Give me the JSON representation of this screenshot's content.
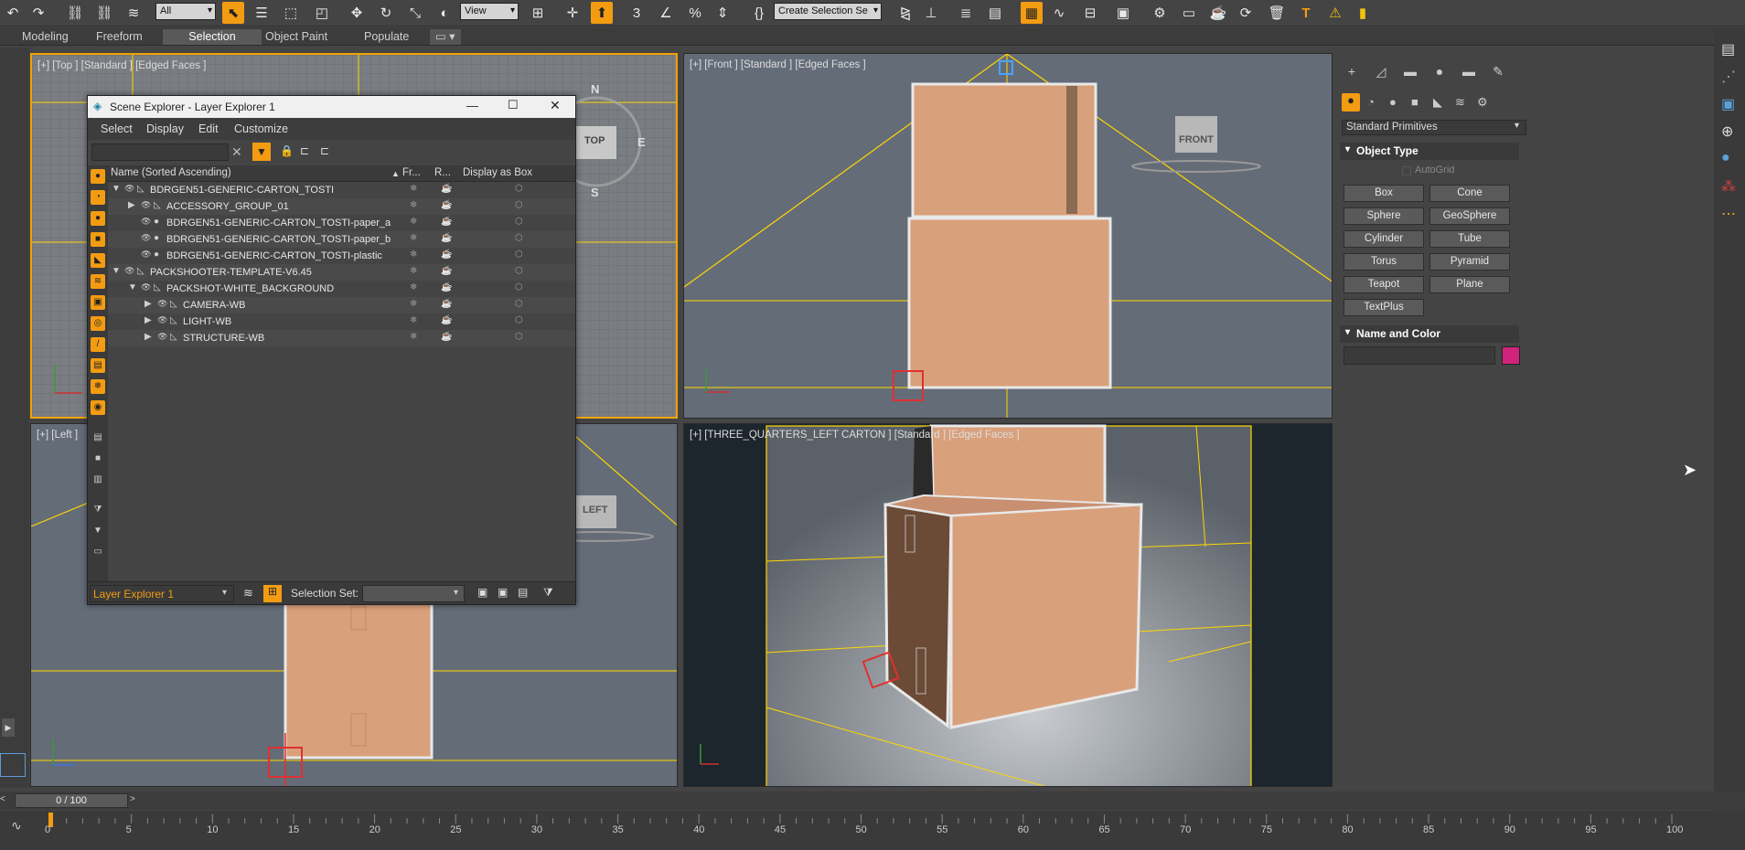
{
  "toolbar": {
    "filter_dropdown": "All",
    "refcoord_dropdown": "View",
    "selection_set": "Create Selection Se",
    "icons": [
      "undo-icon",
      "redo-icon",
      "link-icon",
      "unlink-icon",
      "bind-spacewarp-icon",
      "select-icon",
      "select-by-name-icon",
      "rect-region-icon",
      "window-crossing-icon",
      "move-icon",
      "rotate-icon",
      "scale-icon",
      "placement-icon",
      "pivot-icon",
      "manipulate-icon",
      "snaps-icon",
      "angle-snap-icon",
      "percent-snap-icon",
      "spinner-snap-icon",
      "edit-named-sel-icon",
      "mirror-icon",
      "align-icon",
      "layer-icon",
      "ribbon-icon",
      "curve-editor-icon",
      "schematic-icon",
      "material-editor-icon",
      "render-setup-icon",
      "frame-window-icon",
      "render-icon",
      "render-iter-icon",
      "arnold-icon",
      "trash-icon",
      "text-icon",
      "warning-icon",
      "tag-icon"
    ]
  },
  "ribbon": {
    "tabs": [
      "Modeling",
      "Freeform",
      "Selection",
      "Object Paint",
      "Populate"
    ],
    "selected": "Selection"
  },
  "viewports": {
    "top": {
      "label": "[+] [Top ] [Standard ] [Edged Faces ]",
      "cube": "TOP",
      "compass": [
        "N",
        "E",
        "S"
      ]
    },
    "front": {
      "label": "[+] [Front ] [Standard ] [Edged Faces ]",
      "cube": "FRONT"
    },
    "left": {
      "label": "[+] [Left ]",
      "cube": "LEFT"
    },
    "persp": {
      "label": "[+] [THREE_QUARTERS_LEFT CARTON ] [Standard ] [Edged Faces ]"
    }
  },
  "explorer": {
    "title": "Scene Explorer - Layer Explorer 1",
    "menus": [
      "Select",
      "Display",
      "Edit",
      "Customize"
    ],
    "columns": {
      "name": "Name (Sorted Ascending)",
      "freeze": "Fr...",
      "render": "R...",
      "box": "Display as Box"
    },
    "rows": [
      {
        "name": "BDRGEN51-GENERIC-CARTON_TOSTI",
        "indent": 0,
        "expander": "▼",
        "kind": "layer"
      },
      {
        "name": "ACCESSORY_GROUP_01",
        "indent": 1,
        "expander": "▶",
        "kind": "layer"
      },
      {
        "name": "BDRGEN51-GENERIC-CARTON_TOSTI-paper_a",
        "indent": 1,
        "expander": "",
        "kind": "object"
      },
      {
        "name": "BDRGEN51-GENERIC-CARTON_TOSTI-paper_b",
        "indent": 1,
        "expander": "",
        "kind": "object"
      },
      {
        "name": "BDRGEN51-GENERIC-CARTON_TOSTI-plastic",
        "indent": 1,
        "expander": "",
        "kind": "object"
      },
      {
        "name": "PACKSHOOTER-TEMPLATE-V6.45",
        "indent": 0,
        "expander": "▼",
        "kind": "layer"
      },
      {
        "name": "PACKSHOT-WHITE_BACKGROUND",
        "indent": 1,
        "expander": "▼",
        "kind": "layer"
      },
      {
        "name": "CAMERA-WB",
        "indent": 2,
        "expander": "▶",
        "kind": "layer"
      },
      {
        "name": "LIGHT-WB",
        "indent": 2,
        "expander": "▶",
        "kind": "layer"
      },
      {
        "name": "STRUCTURE-WB",
        "indent": 2,
        "expander": "▶",
        "kind": "layer"
      }
    ],
    "footer": {
      "explorer_name": "Layer Explorer 1",
      "selection_set_label": "Selection Set:"
    }
  },
  "command_panel": {
    "category": "Standard Primitives",
    "object_type_title": "Object Type",
    "autogrid": "AutoGrid",
    "primitives": [
      "Box",
      "Cone",
      "Sphere",
      "GeoSphere",
      "Cylinder",
      "Tube",
      "Torus",
      "Pyramid",
      "Teapot",
      "Plane",
      "TextPlus"
    ],
    "name_color_title": "Name and Color",
    "color": "#d0247c"
  },
  "timeline": {
    "frame_display": "0 / 100",
    "ticks": [
      "0",
      "5",
      "10",
      "15",
      "20",
      "25",
      "30",
      "35",
      "40",
      "45",
      "50",
      "55",
      "60",
      "65",
      "70",
      "75",
      "80",
      "85",
      "90",
      "95",
      "100"
    ]
  },
  "colors": {
    "accent": "#f39c12",
    "grid": "#ffd700",
    "carton": "#d9a07c"
  }
}
